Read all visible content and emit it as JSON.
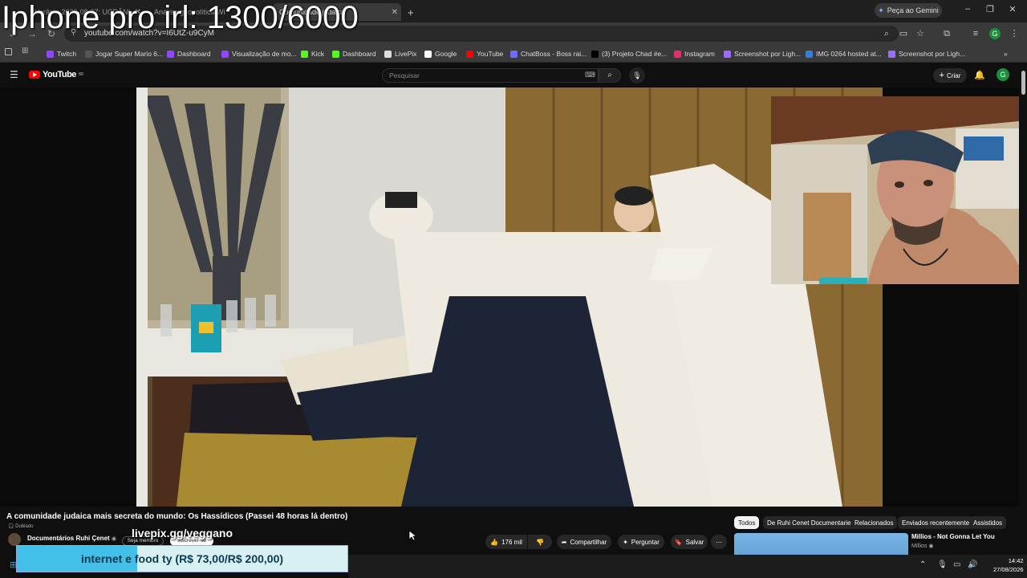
{
  "overlay": {
    "title": "Iphone pro irl: 1300/6000"
  },
  "tabs": [
    {
      "label": "#Ucrânia 2026-08-27: UCRÂNI"
    },
    {
      "label": "Análise geopolítica Wi"
    },
    {
      "label": "Comunidade judaica"
    }
  ],
  "window": {
    "gemini": "Peça ao Gemini"
  },
  "browser": {
    "url": "youtube.com/watch?v=I6UtZ-u9CyM",
    "profile_initial": "G"
  },
  "bookmarks": [
    {
      "label": "Twitch",
      "color": "#9146ff"
    },
    {
      "label": "Jogar Super Mario 6...",
      "color": "#555555"
    },
    {
      "label": "Dashboard",
      "color": "#9146ff"
    },
    {
      "label": "Visualização de mo...",
      "color": "#9146ff"
    },
    {
      "label": "Kick",
      "color": "#53fc18"
    },
    {
      "label": "Dashboard",
      "color": "#53fc18"
    },
    {
      "label": "LivePix",
      "color": "#dddddd"
    },
    {
      "label": "Google",
      "color": "#ffffff"
    },
    {
      "label": "YouTube",
      "color": "#ff0000"
    },
    {
      "label": "ChatBoss - Boss rai...",
      "color": "#6c6cff"
    },
    {
      "label": "(3) Projeto Chad #e...",
      "color": "#000000"
    },
    {
      "label": "Instagram",
      "color": "#e1306c"
    },
    {
      "label": "Screenshot por Ligh...",
      "color": "#9d6cff"
    },
    {
      "label": "IMG 0264 hosted at...",
      "color": "#3a7bd5"
    },
    {
      "label": "Screenshot por Ligh...",
      "color": "#9d6cff"
    }
  ],
  "youtube": {
    "logo": "YouTube",
    "region": "BR",
    "search_placeholder": "Pesquisar",
    "create": "Criar",
    "avatar_initial": "G"
  },
  "video": {
    "title": "A comunidade judaica mais secreta do mundo: Os Hassídicos (Passei 48 horas lá dentro)",
    "dubbed": "Dublado",
    "channel": "Documentários Ruhi Çenet",
    "join": "Seja membro",
    "subscribe": "Inscrever-se",
    "likes": "176 mil",
    "share": "Compartilhar",
    "ask": "Perguntar",
    "save": "Salvar"
  },
  "chips": [
    "Todos",
    "De Ruhi Cenet Documentaries",
    "Relacionados",
    "Enviados recentemente",
    "Assistidos"
  ],
  "recommendation": {
    "title": "Millios - Not Gonna Let You",
    "channel": "Millios"
  },
  "stream": {
    "livepix": "livepix.gg/veggano",
    "donation": "internet e food ty (R$ 73,00/R$ 200,00)",
    "donation_progress": 0.365
  },
  "taskbar": {
    "time": "14:42",
    "date": "27/08/2026"
  }
}
